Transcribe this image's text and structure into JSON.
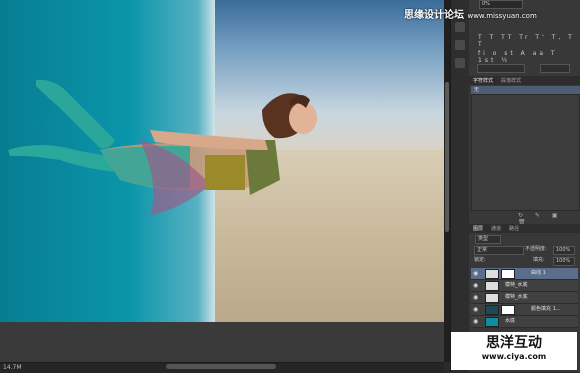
{
  "watermark_top": {
    "cn": "思缘设计论坛",
    "url": "www.missyuan.com"
  },
  "panel": {
    "opacity_value": "0%",
    "char_tabs": [
      "字符样式",
      "段落样式"
    ],
    "selected_style": "无",
    "layer_tabs": [
      "图层",
      "通道",
      "路径"
    ],
    "layer_filter": "类型",
    "blend_mode": "正常",
    "opacity_label": "不透明度:",
    "opacity_pct": "100%",
    "lock_label": "锁定:",
    "fill_label": "填充:",
    "fill_pct": "100%",
    "layers": [
      {
        "name": "曲线 1",
        "selected": true
      },
      {
        "name": "模特_水底",
        "selected": false
      },
      {
        "name": "模特_水底",
        "selected": false
      },
      {
        "name": "颜色填充 1...",
        "selected": false
      },
      {
        "name": "水底",
        "selected": false
      }
    ]
  },
  "status": {
    "zoom": "14.7M"
  },
  "watermark_bottom": {
    "cn": "思洋互动",
    "url": "www.ciya.com"
  },
  "colors": {
    "panel_bg": "#383838",
    "selection": "#5a6d8a"
  }
}
